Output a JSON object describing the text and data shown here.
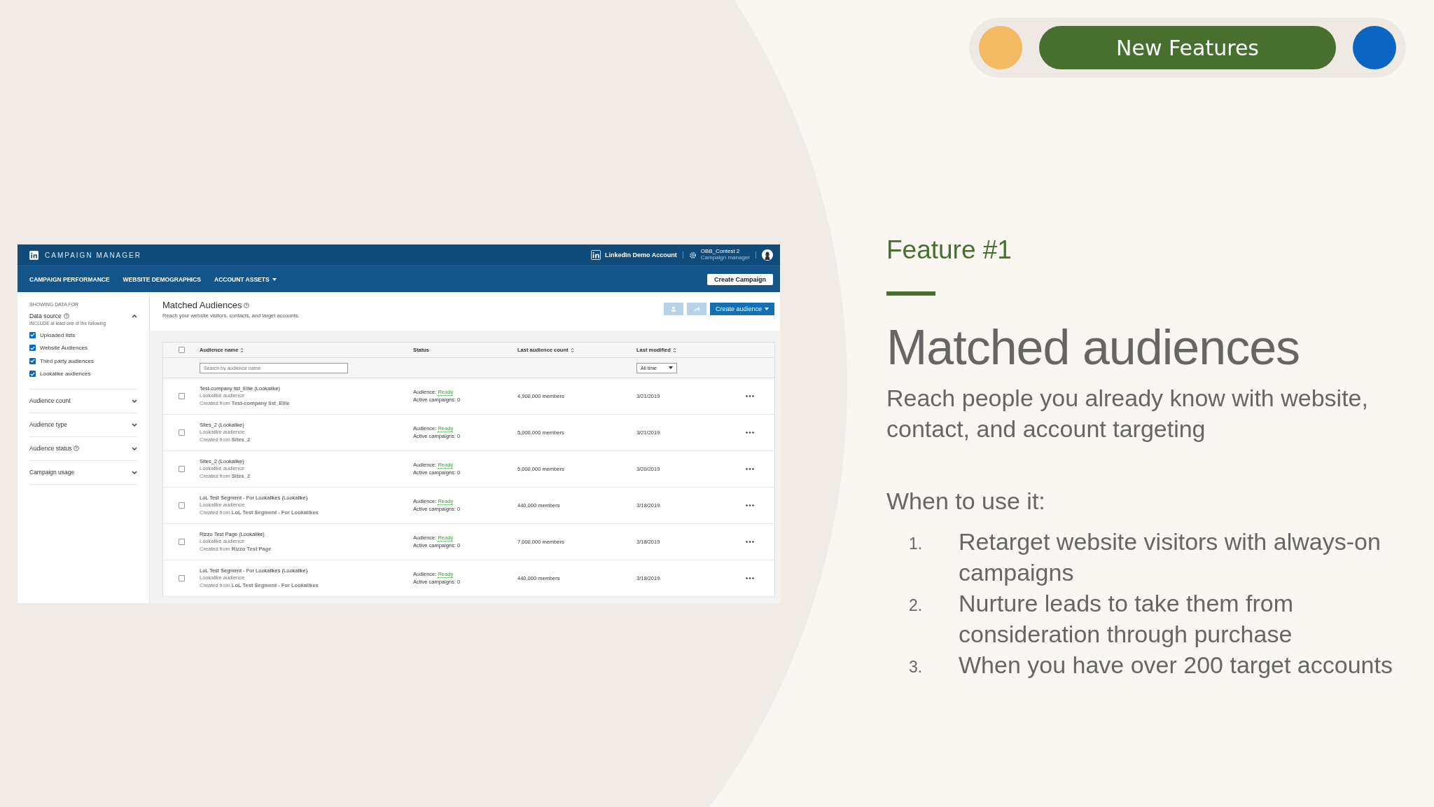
{
  "badge": {
    "label": "New Features",
    "dots": [
      {
        "color": "#f4b963"
      },
      {
        "color": "#0d65c2"
      }
    ]
  },
  "app": {
    "product": "CAMPAIGN MANAGER",
    "account": "LinkedIn Demo Account",
    "user_name": "OBB_Contest 2",
    "user_role": "Campaign manager",
    "nav": [
      {
        "label": "CAMPAIGN PERFORMANCE",
        "dropdown": false
      },
      {
        "label": "WEBSITE DEMOGRAPHICS",
        "dropdown": false
      },
      {
        "label": "ACCOUNT ASSETS",
        "dropdown": true
      }
    ],
    "create_campaign": "Create Campaign",
    "sidebar": {
      "heading": "SHOWING DATA FOR",
      "filters": [
        {
          "label": "Data source",
          "help": true,
          "expanded": true,
          "hint": "INCLUDE at least one of the following",
          "options": [
            {
              "label": "Uploaded lists",
              "checked": true
            },
            {
              "label": "Website Audiences",
              "checked": true
            },
            {
              "label": "Third party audiences",
              "checked": true
            },
            {
              "label": "Lookalike audiences",
              "checked": true
            }
          ]
        },
        {
          "label": "Audience count",
          "help": false,
          "expanded": false
        },
        {
          "label": "Audience type",
          "help": false,
          "expanded": false
        },
        {
          "label": "Audience status",
          "help": true,
          "expanded": false
        },
        {
          "label": "Campaign usage",
          "help": false,
          "expanded": false
        }
      ]
    },
    "page_title": "Matched Audiences",
    "page_subtitle": "Reach your website visitors, contacts, and target accounts.",
    "icon_buttons": [
      {
        "disabled": true
      },
      {
        "disabled": true
      }
    ],
    "create_audience": "Create audience",
    "table": {
      "select_all": false,
      "columns": [
        {
          "label": "Audience name",
          "sortable": true
        },
        {
          "label": "Status",
          "sortable": false
        },
        {
          "label": "Last audience count",
          "sortable": true
        },
        {
          "label": "Last modified",
          "sortable": true
        }
      ],
      "search_placeholder": "Search by audience name",
      "time_filter": "All time",
      "rows": [
        {
          "checked": false,
          "name": "Test-company list_Ellie (Lookalike)",
          "type": "Lookalike audience",
          "source": "Created from **Test-company list_Ellie**",
          "status_label": "Audience:",
          "status": "Ready",
          "campaigns": "Active campaigns: 0",
          "count": "4,900,000 members",
          "modified": "3/21/2019"
        },
        {
          "checked": false,
          "name": "Sites_2 (Lookalike)",
          "type": "Lookalike audience",
          "source": "Created from **Sites_2**",
          "status_label": "Audience:",
          "status": "Ready",
          "campaigns": "Active campaigns: 0",
          "count": "5,000,000 members",
          "modified": "3/21/2019"
        },
        {
          "checked": false,
          "name": "Sites_2 (Lookalike)",
          "type": "Lookalike audience",
          "source": "Created from **Sites_2**",
          "status_label": "Audience:",
          "status": "Ready",
          "campaigns": "Active campaigns: 0",
          "count": "5,000,000 members",
          "modified": "3/20/2019"
        },
        {
          "checked": false,
          "name": "LoL Test Segment - For Lookalikes (Lookalike)",
          "type": "Lookalike audience",
          "source": "Created from **LoL Test Segment - For Lookalikes**",
          "status_label": "Audience:",
          "status": "Ready",
          "campaigns": "Active campaigns: 0",
          "count": "440,000 members",
          "modified": "3/18/2019"
        },
        {
          "checked": false,
          "name": "Rizzo Test Page (Lookalike)",
          "type": "Lookalike audience",
          "source": "Created from **Rizzo Test Page**",
          "status_label": "Audience:",
          "status": "Ready",
          "campaigns": "Active campaigns: 0",
          "count": "7,000,000 members",
          "modified": "3/18/2019"
        },
        {
          "checked": false,
          "name": "LoL Test Segment - For Lookalikes (Lookalike)",
          "type": "Lookalike audience",
          "source": "Created from **LoL Test Segment - For Lookalikes**",
          "status_label": "Audience:",
          "status": "Ready",
          "campaigns": "Active campaigns: 0",
          "count": "440,000 members",
          "modified": "3/18/2019"
        }
      ]
    }
  },
  "feature": {
    "label": "Feature #1",
    "title": "Matched audiences",
    "subtitle": "Reach people you already know with website, contact, and account targeting",
    "when_label": "When to use it:",
    "uses": [
      {
        "number": "1.",
        "text": "Retarget website visitors with always-on campaigns"
      },
      {
        "number": "2.",
        "text": "Nurture leads to take them from consideration through purchase"
      },
      {
        "number": "3.",
        "text": "When you have over 200 target accounts"
      }
    ]
  }
}
